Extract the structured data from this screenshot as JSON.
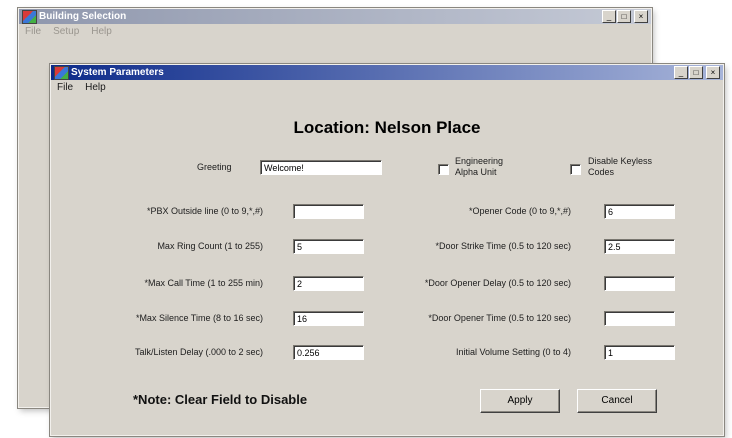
{
  "back_window": {
    "title": "Building Selection",
    "menu": [
      "File",
      "Setup",
      "Help"
    ]
  },
  "window": {
    "title": "System Parameters",
    "menu": [
      "File",
      "Help"
    ],
    "controls": {
      "minimize": "_",
      "maximize": "□",
      "close": "×"
    }
  },
  "location": "Location:  Nelson Place",
  "greeting": {
    "label": "Greeting",
    "value": "Welcome!"
  },
  "checkboxes": {
    "engineering": {
      "line1": "Engineering",
      "line2": "Alpha Unit",
      "checked": false
    },
    "keyless": {
      "line1": "Disable Keyless",
      "line2": "Codes",
      "checked": false
    }
  },
  "left_fields": [
    {
      "label": "*PBX Outside line (0 to 9,*,#)",
      "value": ""
    },
    {
      "label": "Max Ring Count (1 to 255)",
      "value": "5"
    },
    {
      "label": "*Max Call Time (1 to 255 min)",
      "value": "2"
    },
    {
      "label": "*Max Silence Time (8 to 16 sec)",
      "value": "16"
    },
    {
      "label": "Talk/Listen Delay (.000 to 2 sec)",
      "value": "0.256"
    }
  ],
  "right_fields": [
    {
      "label": "*Opener Code (0 to 9,*,#)",
      "value": "6"
    },
    {
      "label": "*Door Strike Time (0.5 to 120 sec)",
      "value": "2.5"
    },
    {
      "label": "*Door Opener Delay (0.5 to 120 sec)",
      "value": ""
    },
    {
      "label": "*Door Opener Time (0.5 to 120 sec)",
      "value": ""
    },
    {
      "label": "Initial Volume Setting (0 to 4)",
      "value": "1"
    }
  ],
  "note": "*Note: Clear Field to Disable",
  "buttons": {
    "apply": "Apply",
    "cancel": "Cancel"
  }
}
